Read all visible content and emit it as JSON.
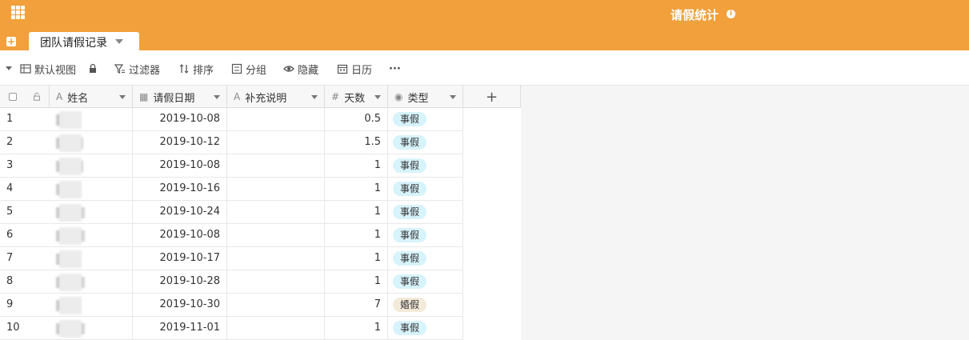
{
  "app": {
    "title": "请假统计",
    "table_tab": "团队请假记录"
  },
  "toolbar": {
    "view": "默认视图",
    "filter": "过滤器",
    "sort": "排序",
    "group": "分组",
    "hide": "隐藏",
    "calendar": "日历",
    "more": "···"
  },
  "columns": [
    {
      "label": "姓名",
      "icon": "text-icon"
    },
    {
      "label": "请假日期",
      "icon": "calendar-icon"
    },
    {
      "label": "补充说明",
      "icon": "text-icon"
    },
    {
      "label": "天数",
      "icon": "number-icon"
    },
    {
      "label": "类型",
      "icon": "single-select-icon"
    }
  ],
  "add_column": "+",
  "colors": {
    "header": "#f1a03c",
    "tag_personal": "#d7f3fb",
    "tag_marriage": "#f4ead9"
  },
  "rows": [
    {
      "idx": "1",
      "name_tail": "鹏",
      "date": "2019-10-08",
      "note": "",
      "days": "0.5",
      "type": "事假"
    },
    {
      "idx": "2",
      "name_tail": "丑",
      "date": "2019-10-12",
      "note": "",
      "days": "1.5",
      "type": "事假"
    },
    {
      "idx": "3",
      "name_tail": "",
      "date": "2019-10-08",
      "note": "",
      "days": "1",
      "type": "事假"
    },
    {
      "idx": "4",
      "name_tail": "",
      "date": "2019-10-16",
      "note": "",
      "days": "1",
      "type": "事假"
    },
    {
      "idx": "5",
      "name_tail": "",
      "date": "2019-10-24",
      "note": "",
      "days": "1",
      "type": "事假"
    },
    {
      "idx": "6",
      "name_tail": "",
      "date": "2019-10-08",
      "note": "",
      "days": "1",
      "type": "事假"
    },
    {
      "idx": "7",
      "name_tail": "",
      "date": "2019-10-17",
      "note": "",
      "days": "1",
      "type": "事假"
    },
    {
      "idx": "8",
      "name_tail": "",
      "date": "2019-10-28",
      "note": "",
      "days": "1",
      "type": "事假"
    },
    {
      "idx": "9",
      "name_tail": "",
      "date": "2019-10-30",
      "note": "",
      "days": "7",
      "type": "婚假"
    },
    {
      "idx": "10",
      "name_tail": "",
      "date": "2019-11-01",
      "note": "",
      "days": "1",
      "type": "事假"
    }
  ]
}
